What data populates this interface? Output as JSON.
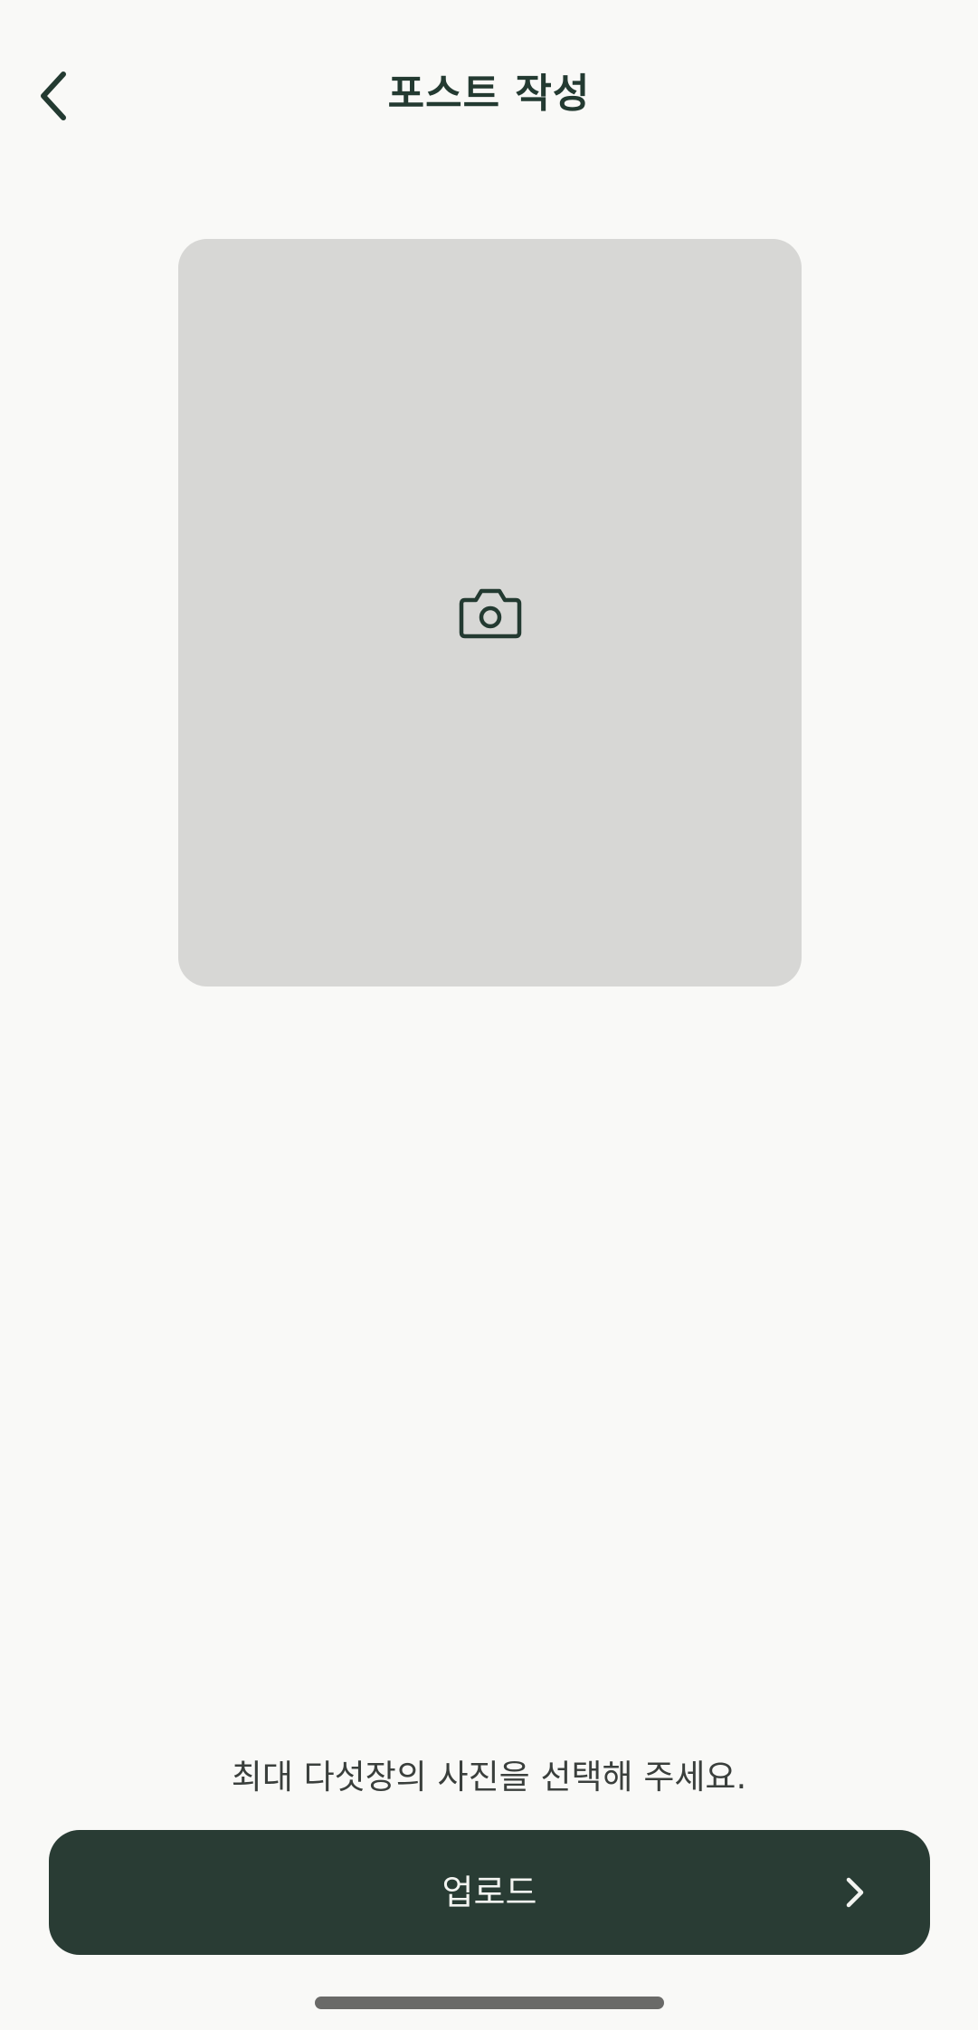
{
  "header": {
    "title": "포스트 작성",
    "back_icon": "chevron-left-icon"
  },
  "photo_picker": {
    "icon": "camera-icon"
  },
  "hint_text": "최대 다섯장의 사진을 선택해 주세요.",
  "upload_button": {
    "label": "업로드",
    "icon": "chevron-right-icon"
  },
  "colors": {
    "background": "#f9f9f7",
    "primary": "#293c34",
    "placeholder": "#d7d7d5",
    "button_text": "#f3f4f1"
  }
}
